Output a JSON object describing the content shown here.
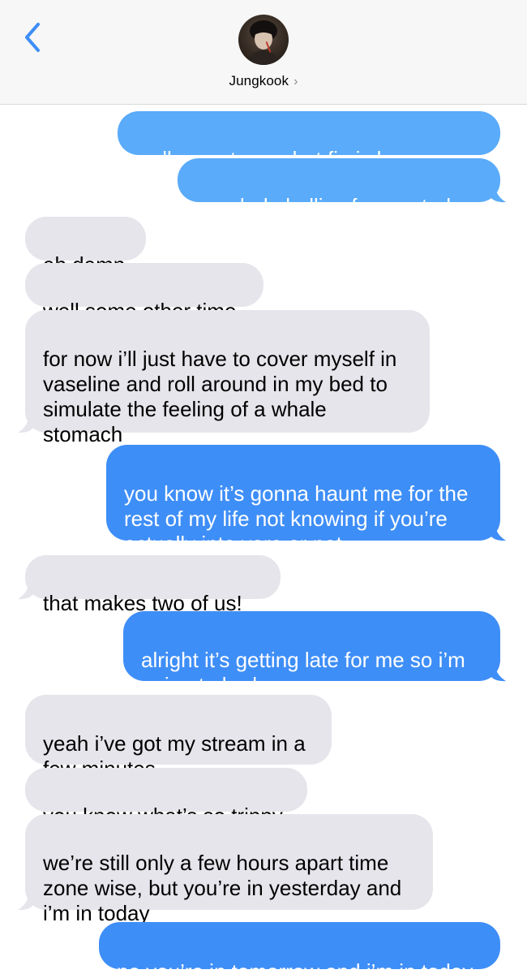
{
  "header": {
    "back_icon": "chevron-left-icon",
    "contact_name": "Jungkook",
    "chevron": "›",
    "accent_color": "#3e8ef7",
    "avatar_icon": "contact-avatar-photo"
  },
  "colors": {
    "incoming_bubble": "#e6e5eb",
    "outgoing_bubble": "#3e8ef7",
    "outgoing_bubble_light": "#5aabf9",
    "header_background": "#f7f7f7"
  },
  "messages": [
    {
      "direction": "outgoing",
      "text": "well sorry to say but fin is long gone"
    },
    {
      "direction": "outgoing",
      "text": "no whale bellies for you today"
    },
    {
      "direction": "incoming",
      "text": "ah damn"
    },
    {
      "direction": "incoming",
      "text": "well some other time"
    },
    {
      "direction": "incoming",
      "text": "for now i’ll just have to cover myself in vaseline and roll around in my bed to simulate the feeling of a whale stomach"
    },
    {
      "direction": "outgoing",
      "text": "you know it’s gonna haunt me for the rest of my life not knowing if you’re actually into vore or not"
    },
    {
      "direction": "incoming",
      "text": "that makes two of us!"
    },
    {
      "direction": "outgoing",
      "text": "alright it’s getting late for me so i’m going to bed"
    },
    {
      "direction": "incoming",
      "text": "yeah i’ve got my stream in a few minutes"
    },
    {
      "direction": "incoming",
      "text": "you know what’s so trippy"
    },
    {
      "direction": "incoming",
      "text": "we’re still only a few hours apart time zone wise, but you’re in yesterday and i’m in today"
    },
    {
      "direction": "outgoing",
      "text": "no you’re in tomorrow and i’m in today"
    }
  ]
}
